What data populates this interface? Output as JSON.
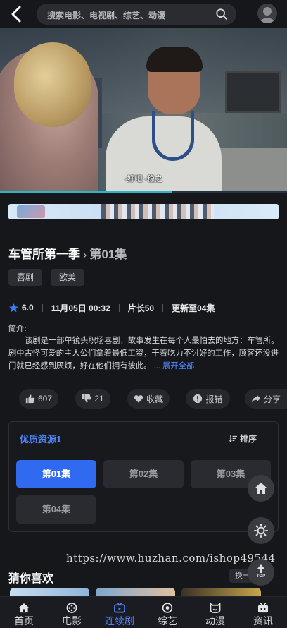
{
  "search": {
    "placeholder": "搜索电影、电视剧、综艺、动漫"
  },
  "video": {
    "subtitle": "-好吧 -稳之"
  },
  "show": {
    "title": "车管所第一季",
    "episode": "第01集",
    "tags": [
      "喜剧",
      "欧美"
    ],
    "rating": "6.0",
    "date": "11月05日 00:32",
    "duration": "片长50",
    "update": "更新至04集",
    "intro_label": "简介:",
    "intro": "该剧是一部单镜头职场喜剧，故事发生在每个人最怕去的地方：车管所。剧中古怪可爱的主人公们拿着最低工资，干着吃力不讨好的工作，顾客还没进门就已经感到厌烦，好在他们拥有彼此。",
    "more_dots": "...",
    "more": "展开全部"
  },
  "actions": {
    "like": "607",
    "dislike": "21",
    "favorite": "收藏",
    "report": "报错",
    "share": "分享"
  },
  "episodes": {
    "source": "优质资源1",
    "sort": "排序",
    "items": [
      "第01集",
      "第02集",
      "第03集",
      "第04集"
    ]
  },
  "fab": {
    "top": "TOP"
  },
  "watermark": "https://www.huzhan.com/ishop49544",
  "guess": {
    "title": "猜你喜欢",
    "swap": "换一"
  },
  "nav": [
    "首页",
    "电影",
    "连续剧",
    "综艺",
    "动漫",
    "资讯"
  ],
  "colors": {
    "accent": "#2f6af0",
    "link": "#4f86ff",
    "background": "#16171b"
  }
}
